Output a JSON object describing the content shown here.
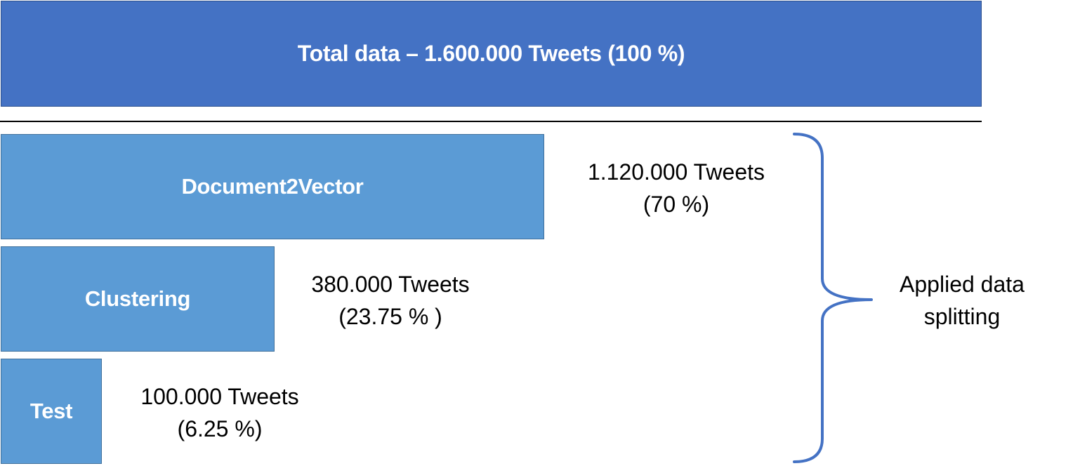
{
  "total": {
    "label": "Total data – 1.600.000 Tweets (100 %)"
  },
  "splits": [
    {
      "name": "Document2Vector",
      "count": "1.120.000 Tweets",
      "percent": "(70 %)"
    },
    {
      "name": "Clustering",
      "count": "380.000 Tweets",
      "percent": "(23.75 % )"
    },
    {
      "name": "Test",
      "count": "100.000 Tweets",
      "percent": "(6.25 %)"
    }
  ],
  "bracket_label": {
    "line1": "Applied data",
    "line2": "splitting"
  },
  "colors": {
    "total_fill": "#4472c4",
    "split_fill": "#5b9bd5",
    "bracket_stroke": "#4472c4",
    "divider": "#000000"
  }
}
